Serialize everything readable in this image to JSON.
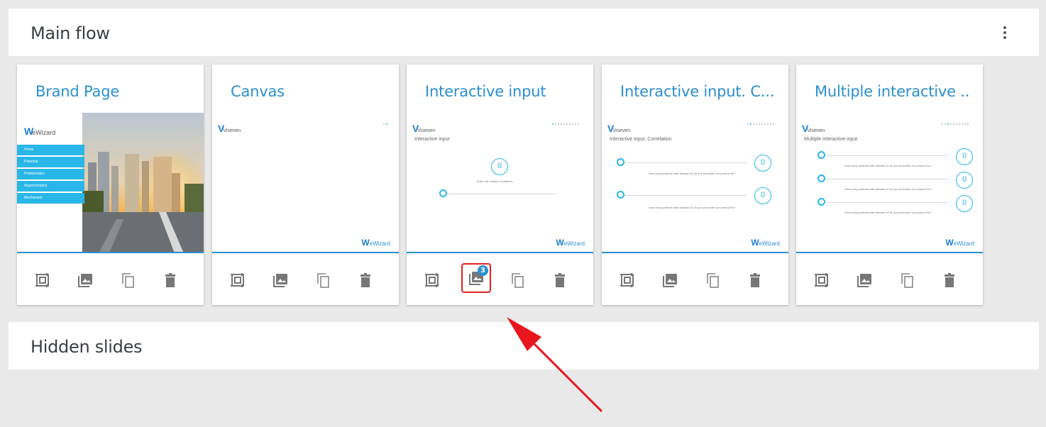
{
  "main_flow": {
    "title": "Main flow",
    "more_menu_icon": "more-vert-icon"
  },
  "hidden_slides": {
    "title": "Hidden slides"
  },
  "action_icons": {
    "frame": "frame-icon",
    "images": "images-icon",
    "copy": "copy-icon",
    "delete": "trash-icon"
  },
  "cards": [
    {
      "title": "Brand Page",
      "thumb": {
        "logo": "eWizard",
        "menu": [
          "Home",
          "Potential",
          "Problematics",
          "Argumentation",
          "Mechanism"
        ]
      }
    },
    {
      "title": "Canvas",
      "thumb": {
        "logo": "Viseven",
        "footer_logo": "eWizard"
      }
    },
    {
      "title": "Interactive input",
      "images_badge": "3",
      "thumb": {
        "logo": "Viseven",
        "subtitle": "Interactive input",
        "value": "0",
        "caption": "Enter the number of patients",
        "footer_logo": "eWizard"
      }
    },
    {
      "title": "Interactive input. C...",
      "thumb": {
        "logo": "Viseven",
        "subtitle": "Interactive input. Correlation",
        "values": [
          "0",
          "0"
        ],
        "questions": [
          "How many patients with disease #1 do you prescribe our product for?",
          "How many patients with disease #2 do you prescribe our product for?"
        ],
        "footer_logo": "eWizard"
      }
    },
    {
      "title": "Multiple interactive ...",
      "thumb": {
        "logo": "Viseven",
        "subtitle": "Multiple interactive input",
        "values": [
          "0",
          "0",
          "0"
        ],
        "questions": [
          "How many patients with disease #1 do you prescribe our product for?",
          "How many patients with disease #2 do you prescribe our product for?",
          "How many patients with disease #3 do you prescribe our product for?"
        ],
        "footer_logo": "eWizard"
      }
    }
  ],
  "colors": {
    "accent": "#2b8fcf",
    "highlight_border": "#e02020",
    "annotation_arrow": "#e8161e"
  }
}
